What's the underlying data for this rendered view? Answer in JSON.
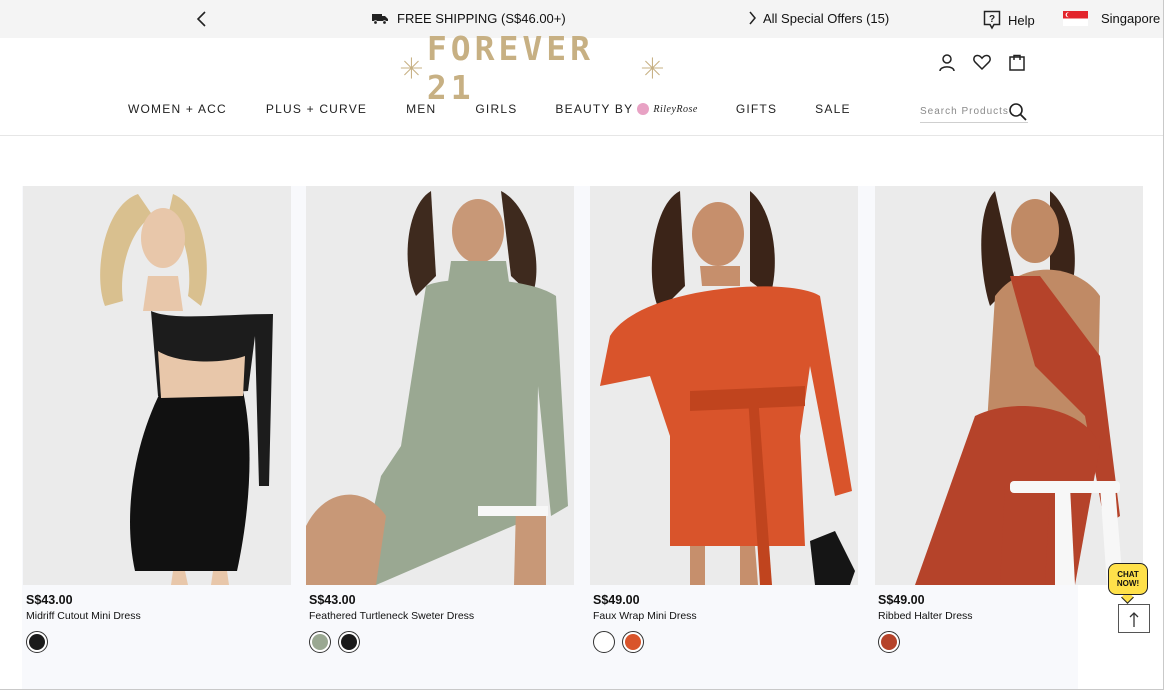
{
  "promo": {
    "shipping_text": "FREE SHIPPING (S$46.00+)",
    "offers_text": "All Special Offers (15)",
    "help_label": "Help",
    "region_label": "Singapore"
  },
  "brand": {
    "logo_text": "FOREVER 21"
  },
  "nav": {
    "items": [
      {
        "label": "WOMEN + ACC"
      },
      {
        "label": "PLUS + CURVE"
      },
      {
        "label": "MEN"
      },
      {
        "label": "GIRLS"
      },
      {
        "label": "BEAUTY BY",
        "brand": "RileyRose"
      },
      {
        "label": "GIFTS"
      },
      {
        "label": "SALE"
      }
    ]
  },
  "search": {
    "placeholder": "Search Products",
    "value": ""
  },
  "icons": {
    "truck": "truck-icon",
    "help": "help-icon",
    "account": "user-icon",
    "wishlist": "heart-icon",
    "bag": "shopping-bag-icon",
    "search": "search-icon"
  },
  "products": [
    {
      "price": "S$43.00",
      "name": "Midriff Cutout Mini Dress",
      "swatches": [
        "#1a1a1a"
      ]
    },
    {
      "price": "S$43.00",
      "name": "Feathered Turtleneck Sweter Dress",
      "swatches": [
        "#9aa892",
        "#1a1a1a"
      ]
    },
    {
      "price": "S$49.00",
      "name": "Faux Wrap Mini Dress",
      "swatches": [
        "#ffffff",
        "#d9542b"
      ]
    },
    {
      "price": "S$49.00",
      "name": "Ribbed Halter Dress",
      "swatches": [
        "#b5432a"
      ]
    }
  ],
  "chat": {
    "line1": "CHAT",
    "line2": "NOW!"
  },
  "colors": {
    "logo_gold": "#c7b083",
    "promo_bg": "#f4f4f4",
    "chat_yellow": "#ffe14a"
  }
}
